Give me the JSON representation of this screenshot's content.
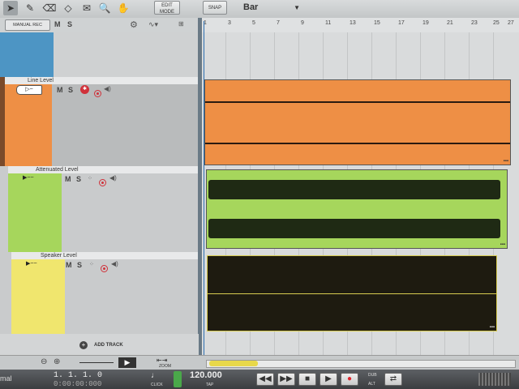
{
  "toolbar": {
    "edit_mode_label": "EDIT MODE",
    "snap_label": "SNAP",
    "grid_value": "Bar"
  },
  "track_header": {
    "manual_rec_label": "MANUAL REC",
    "mute_label": "M",
    "solo_label": "S"
  },
  "ruler": {
    "bars": [
      "1",
      "3",
      "5",
      "7",
      "9",
      "11",
      "13",
      "15",
      "17",
      "19",
      "21",
      "23",
      "25",
      "27"
    ]
  },
  "tracks": [
    {
      "name": "",
      "color": "#4d95c4"
    },
    {
      "name": "Line Level",
      "color": "#ee8f45",
      "mute": "M",
      "solo": "S"
    },
    {
      "name": "Attenuated Level",
      "color": "#a6d65c",
      "mute": "M",
      "solo": "S"
    },
    {
      "name": "Speaker Level",
      "color": "#f0e66e",
      "mute": "M",
      "solo": "S"
    }
  ],
  "add_track_label": "ADD TRACK",
  "zoom_label": "ZOOM",
  "transport": {
    "position": "1. 1. 1.   0",
    "position_sub": "0:00:00:000",
    "left_label": "mal",
    "click_label": "CLICK",
    "tempo": "120.000",
    "tap_label": "TAP",
    "dub_label": "DUB",
    "alt_label": "ALT"
  }
}
